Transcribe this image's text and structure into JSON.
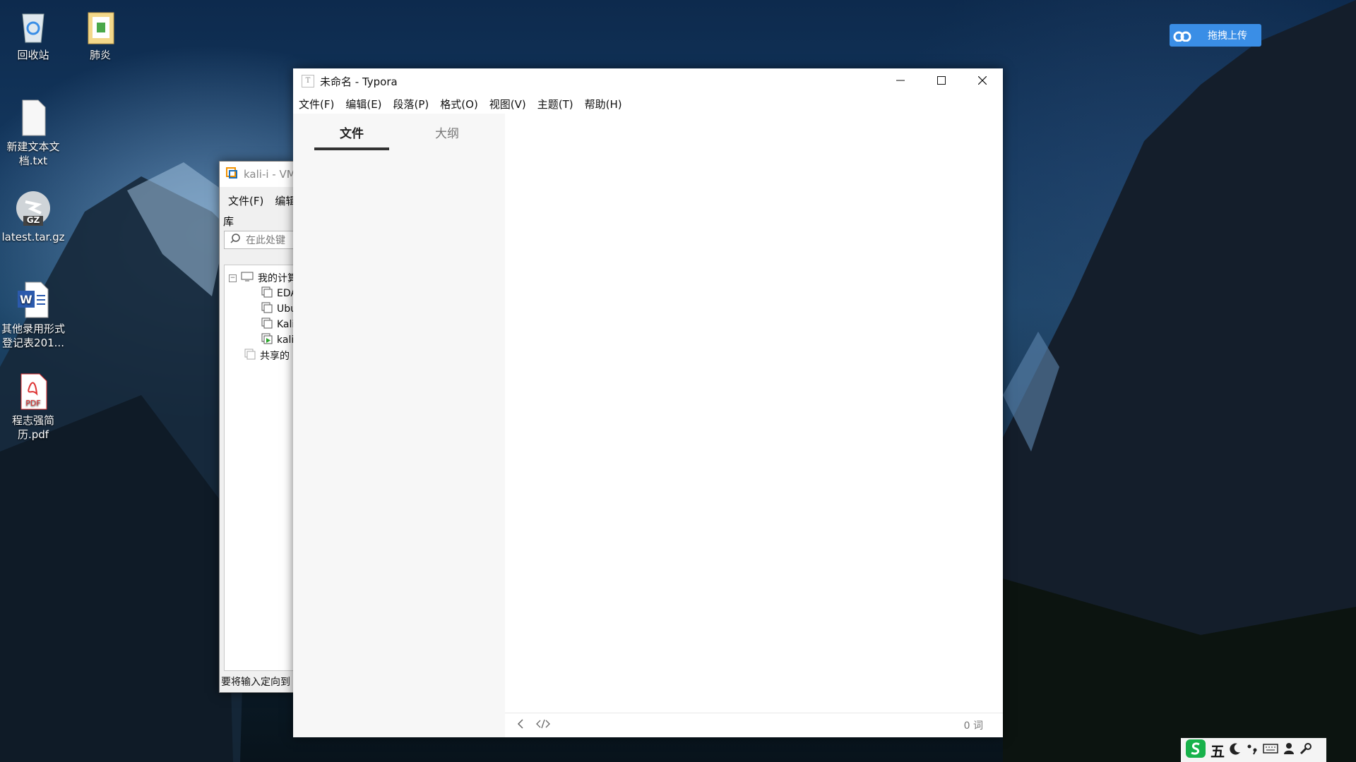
{
  "desktop": {
    "icons": [
      {
        "name": "recycle-bin",
        "label": "回收站"
      },
      {
        "name": "folder",
        "label": "肺炎"
      },
      {
        "name": "txt-file",
        "label": "新建文本文档.txt"
      },
      {
        "name": "gz-file",
        "label": "latest.tar.gz",
        "badge": "GZ"
      },
      {
        "name": "word-file",
        "label": "其他录用形式登记表201...",
        "badge": "W"
      },
      {
        "name": "pdf-file",
        "label": "程志强简历.pdf",
        "badge": "PDF"
      }
    ],
    "upload_button": "拖拽上传"
  },
  "vmware": {
    "title": "kali-i - VM",
    "menu": [
      "文件(F)",
      "编辑"
    ],
    "library_label": "库",
    "search_placeholder": "在此处键",
    "tree": [
      "我的计算",
      "EDA",
      "Ubu",
      "Kali",
      "kali",
      "共享的"
    ],
    "status": "要将输入定向到"
  },
  "typora": {
    "title": "未命名 - Typora",
    "app_icon": "T",
    "menu": [
      "文件(F)",
      "编辑(E)",
      "段落(P)",
      "格式(O)",
      "视图(V)",
      "主题(T)",
      "帮助(H)"
    ],
    "tabs": {
      "files": "文件",
      "outline": "大纲"
    },
    "word_count": "0 词"
  },
  "tray": {
    "ime_mode": "五"
  },
  "colors": {
    "accent": "#3a8ee6",
    "active_tab_underline": "#333333",
    "sidebar": "#f7f7f7"
  }
}
